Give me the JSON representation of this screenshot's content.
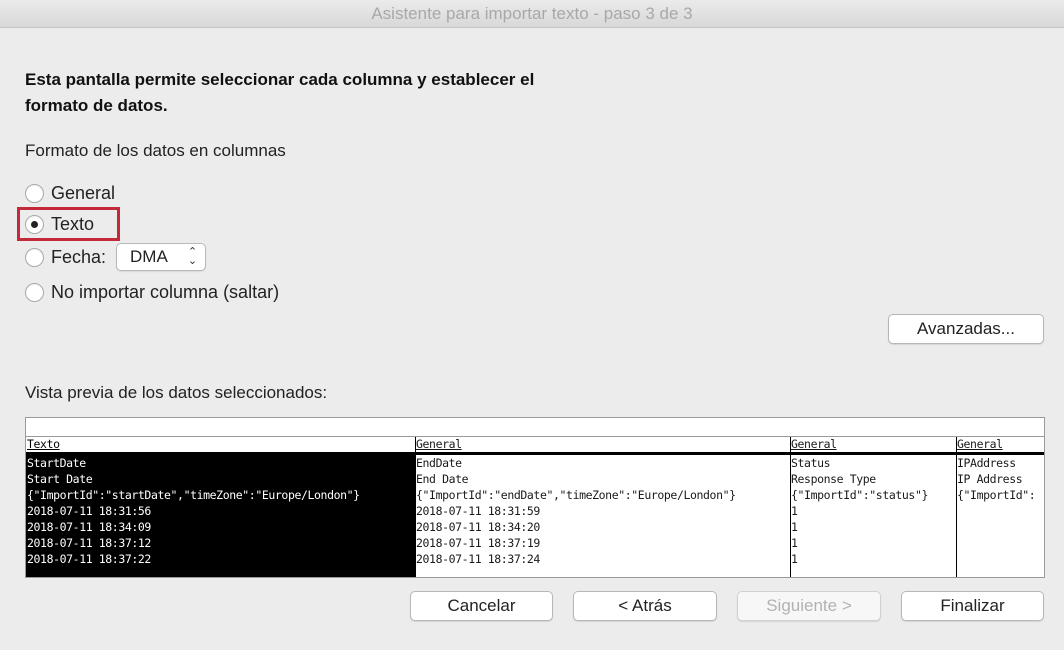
{
  "window": {
    "title": "Asistente para importar texto - paso 3 de 3"
  },
  "heading": {
    "line1": "Esta pantalla permite seleccionar cada columna y establecer el",
    "line2": "formato de datos."
  },
  "format_section": {
    "label": "Formato de los datos en columnas",
    "options": [
      {
        "label": "General",
        "selected": false
      },
      {
        "label": "Texto",
        "selected": true
      },
      {
        "label": "Fecha:",
        "selected": false
      },
      {
        "label": "No importar columna (saltar)",
        "selected": false
      }
    ],
    "date_format": "DMA"
  },
  "advanced_button": "Avanzadas...",
  "preview": {
    "label": "Vista previa de los datos seleccionados:",
    "columns": [
      {
        "type": "Texto",
        "selected": true,
        "cells": [
          "StartDate",
          "Start Date",
          "{\"ImportId\":\"startDate\",\"timeZone\":\"Europe/London\"}",
          "2018-07-11 18:31:56",
          "2018-07-11 18:34:09",
          "2018-07-11 18:37:12",
          "2018-07-11 18:37:22"
        ]
      },
      {
        "type": "General",
        "selected": false,
        "cells": [
          "EndDate",
          "End Date",
          "{\"ImportId\":\"endDate\",\"timeZone\":\"Europe/London\"}",
          "2018-07-11 18:31:59",
          "2018-07-11 18:34:20",
          "2018-07-11 18:37:19",
          "2018-07-11 18:37:24"
        ]
      },
      {
        "type": "General",
        "selected": false,
        "cells": [
          "Status",
          "Response Type",
          "{\"ImportId\":\"status\"}",
          "1",
          "1",
          "1",
          "1"
        ]
      },
      {
        "type": "General",
        "selected": false,
        "cells": [
          "IPAddress",
          "IP Address",
          "{\"ImportId\":",
          "",
          "",
          "",
          ""
        ]
      }
    ]
  },
  "buttons": {
    "cancel": "Cancelar",
    "back": "< Atrás",
    "next": "Siguiente >",
    "finish": "Finalizar"
  }
}
